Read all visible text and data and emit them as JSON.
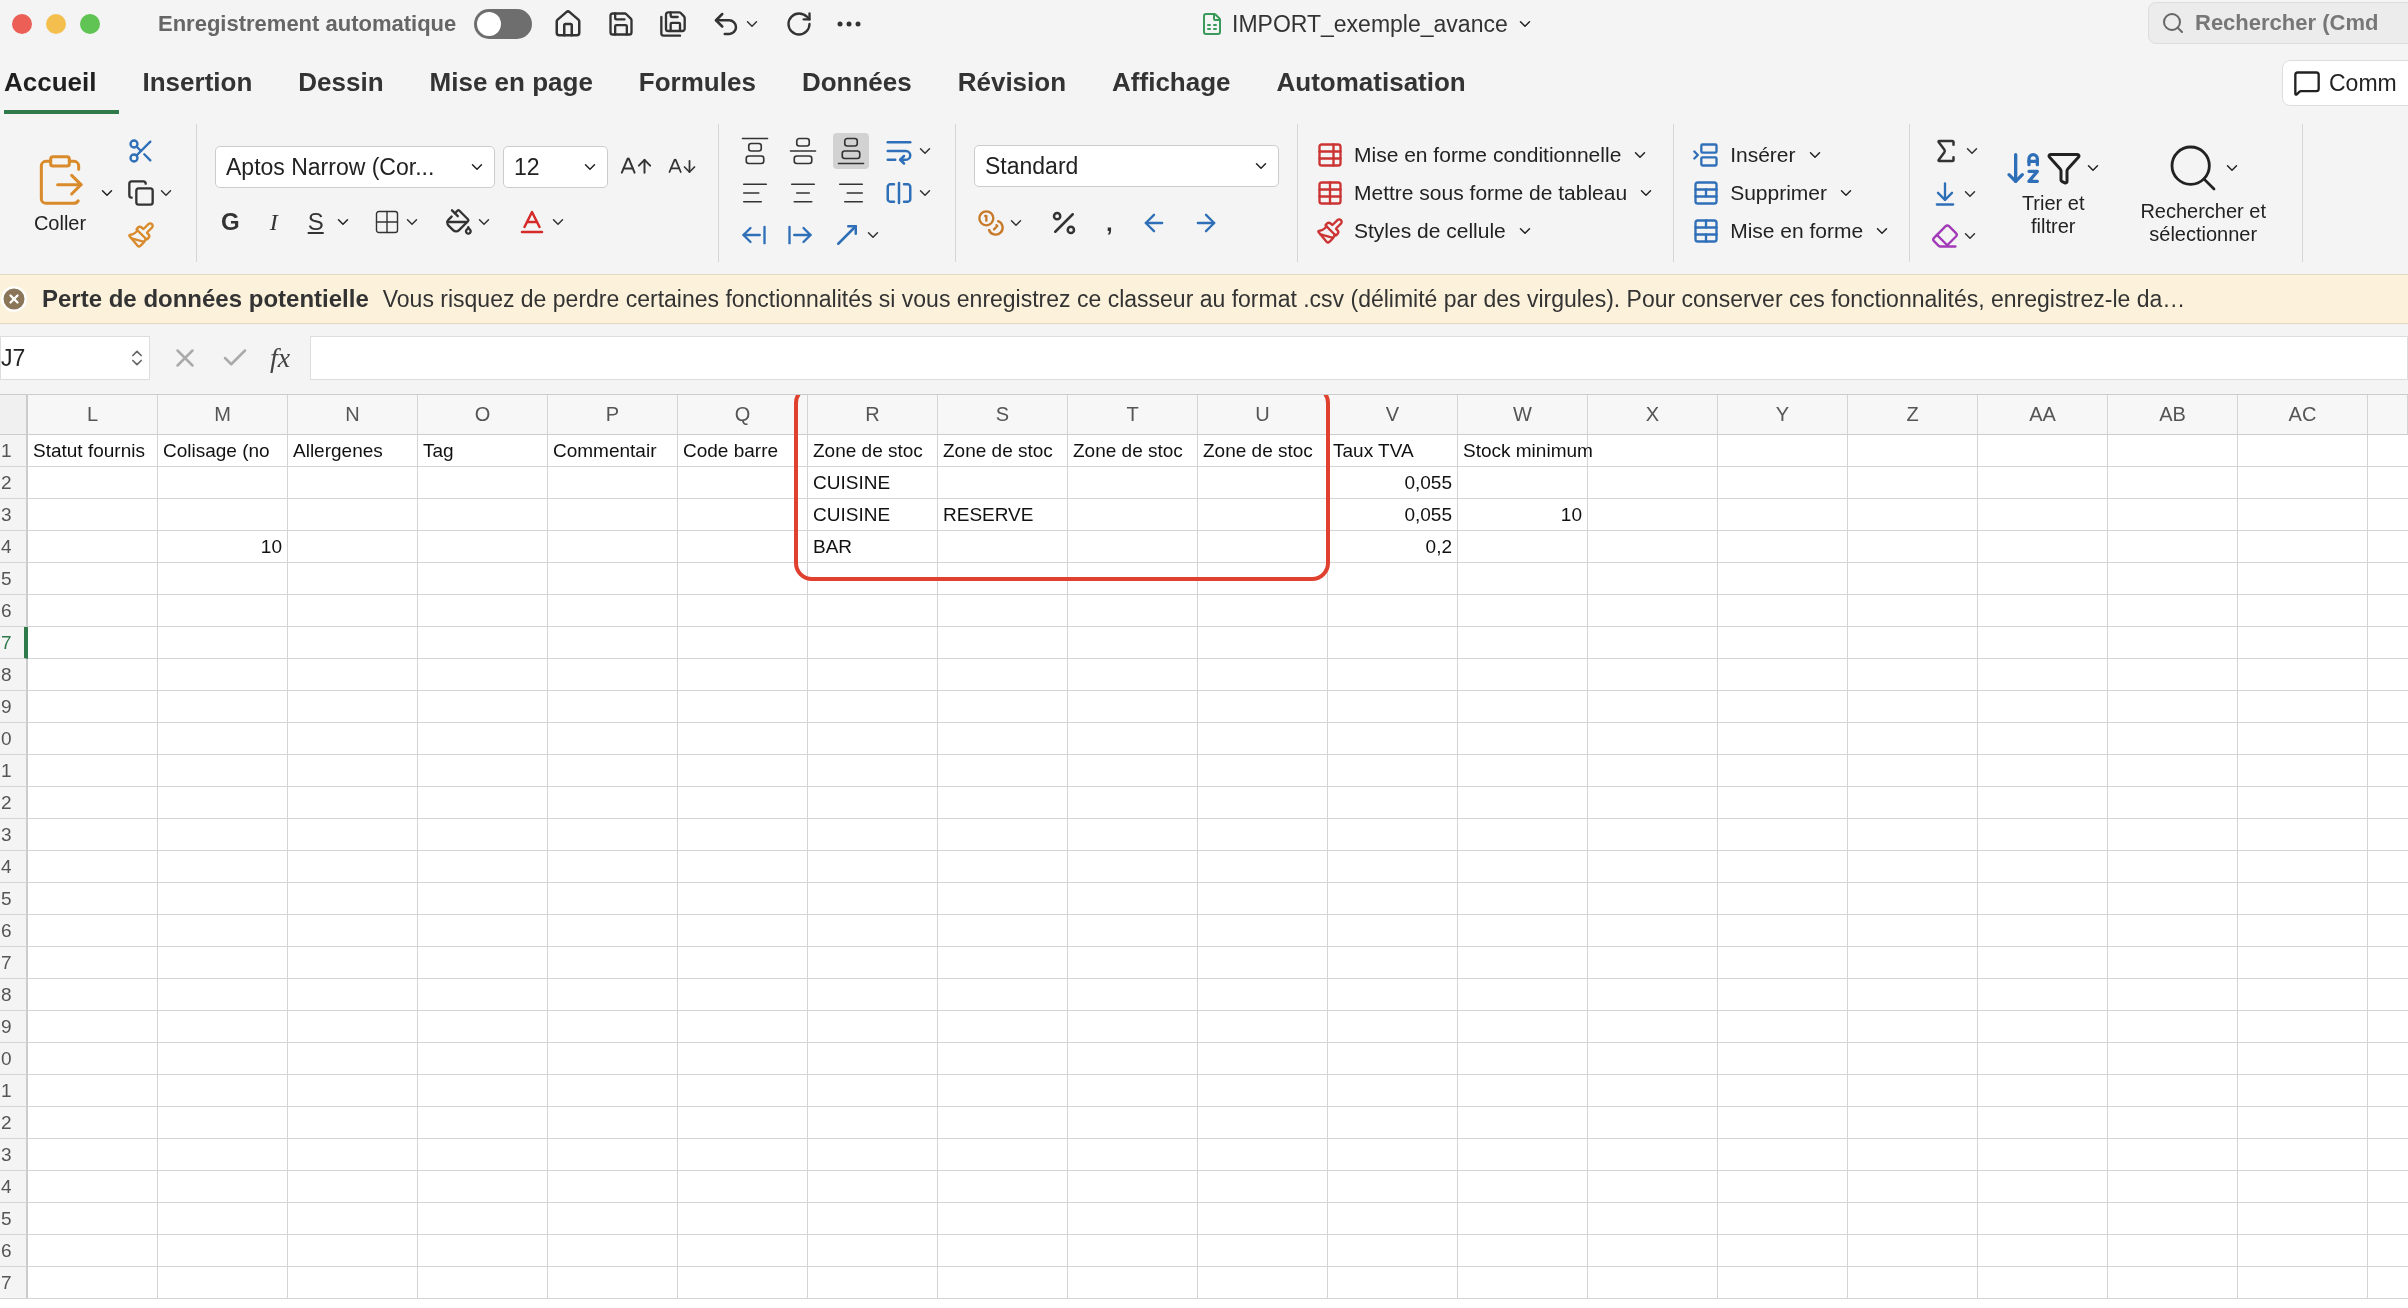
{
  "titlebar": {
    "autosave_label": "Enregistrement automatique",
    "autosave_on": false,
    "document_title": "IMPORT_exemple_avance",
    "search_placeholder": "Rechercher (Cmd"
  },
  "tabs": [
    {
      "label": "Accueil",
      "selected": true
    },
    {
      "label": "Insertion",
      "selected": false
    },
    {
      "label": "Dessin",
      "selected": false
    },
    {
      "label": "Mise en page",
      "selected": false
    },
    {
      "label": "Formules",
      "selected": false
    },
    {
      "label": "Données",
      "selected": false
    },
    {
      "label": "Révision",
      "selected": false
    },
    {
      "label": "Affichage",
      "selected": false
    },
    {
      "label": "Automatisation",
      "selected": false
    }
  ],
  "comments_button": "Comm",
  "ribbon": {
    "paste_label": "Coller",
    "font_name": "Aptos Narrow (Cor...",
    "font_size": "12",
    "bold": "G",
    "italic": "I",
    "underline": "S",
    "number_format": "Standard",
    "comma_style": ",",
    "styles": [
      "Mise en forme conditionnelle",
      "Mettre sous forme de tableau",
      "Styles de cellule"
    ],
    "cells": [
      "Insérer",
      "Supprimer",
      "Mise en forme"
    ],
    "sort_label": "Trier et filtrer",
    "find_label": "Rechercher et sélectionner"
  },
  "warning": {
    "title": "Perte de données potentielle",
    "message": "Vous risquez de perdre certaines fonctionnalités si vous enregistrez ce classeur au format .csv (délimité par des virgules). Pour conserver ces fonctionnalités, enregistrez-le da…"
  },
  "formula_bar": {
    "name_box": "J7",
    "fx": "fx"
  },
  "columns": [
    "L",
    "M",
    "N",
    "O",
    "P",
    "Q",
    "R",
    "S",
    "T",
    "U",
    "V",
    "W",
    "X",
    "Y",
    "Z",
    "AA",
    "AB",
    "AC"
  ],
  "annotation": {
    "kind": "frame"
  },
  "rows": [
    {
      "number": "1",
      "selected": false,
      "cells": [
        {
          "text": "Statut fournis",
          "kind": "text"
        },
        {
          "text": "Colisage (no",
          "kind": "text"
        },
        {
          "text": "Allergenes",
          "kind": "text"
        },
        {
          "text": "Tag",
          "kind": "text"
        },
        {
          "text": "Commentair",
          "kind": "text"
        },
        {
          "text": "Code barre",
          "kind": "text"
        },
        {
          "text": "Zone de stoc",
          "kind": "text"
        },
        {
          "text": "Zone de stoc",
          "kind": "text"
        },
        {
          "text": "Zone de stoc",
          "kind": "text"
        },
        {
          "text": "Zone de stoc",
          "kind": "text"
        },
        {
          "text": "Taux TVA",
          "kind": "text"
        },
        {
          "text": "Stock minimum",
          "kind": "text"
        }
      ]
    },
    {
      "number": "2",
      "selected": false,
      "cells": [
        null,
        null,
        null,
        null,
        null,
        null,
        {
          "text": "CUISINE",
          "kind": "text"
        },
        null,
        null,
        null,
        {
          "text": "0,055",
          "kind": "number"
        }
      ]
    },
    {
      "number": "3",
      "selected": false,
      "cells": [
        null,
        null,
        null,
        null,
        null,
        null,
        {
          "text": "CUISINE",
          "kind": "text"
        },
        {
          "text": "RESERVE",
          "kind": "text"
        },
        null,
        null,
        {
          "text": "0,055",
          "kind": "number"
        },
        {
          "text": "10",
          "kind": "number"
        }
      ]
    },
    {
      "number": "4",
      "selected": false,
      "cells": [
        null,
        {
          "text": "10",
          "kind": "number"
        },
        null,
        null,
        null,
        null,
        {
          "text": "BAR",
          "kind": "text"
        },
        null,
        null,
        null,
        {
          "text": "0,2",
          "kind": "number"
        }
      ]
    },
    {
      "number": "5",
      "selected": false
    },
    {
      "number": "6",
      "selected": false
    },
    {
      "number": "7",
      "selected": true
    },
    {
      "number": "8",
      "selected": false
    },
    {
      "number": "9",
      "selected": false
    },
    {
      "number": "0",
      "selected": false
    },
    {
      "number": "1",
      "selected": false
    },
    {
      "number": "2",
      "selected": false
    },
    {
      "number": "3",
      "selected": false
    },
    {
      "number": "4",
      "selected": false
    },
    {
      "number": "5",
      "selected": false
    },
    {
      "number": "6",
      "selected": false
    },
    {
      "number": "7",
      "selected": false
    },
    {
      "number": "8",
      "selected": false
    },
    {
      "number": "9",
      "selected": false
    },
    {
      "number": "0",
      "selected": false
    },
    {
      "number": "1",
      "selected": false
    },
    {
      "number": "2",
      "selected": false
    },
    {
      "number": "3",
      "selected": false
    },
    {
      "number": "4",
      "selected": false
    },
    {
      "number": "5",
      "selected": false
    },
    {
      "number": "6",
      "selected": false
    },
    {
      "number": "7",
      "selected": false
    }
  ]
}
